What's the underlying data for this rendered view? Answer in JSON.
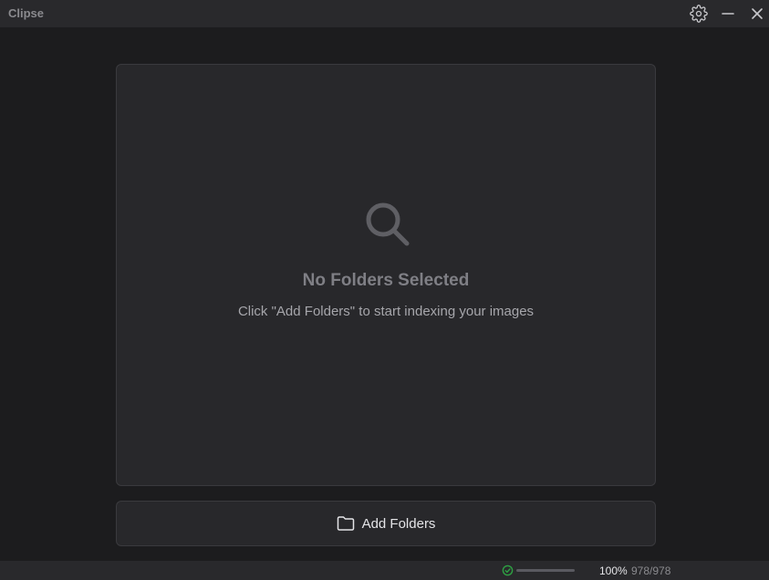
{
  "app": {
    "title": "Clipse"
  },
  "titlebar": {
    "settings_icon": "gear-icon",
    "minimize_icon": "minimize-icon",
    "close_icon": "close-icon"
  },
  "empty_state": {
    "icon": "search-icon",
    "title": "No Folders Selected",
    "subtitle": "Click \"Add Folders\" to start indexing your images"
  },
  "add_folders": {
    "icon": "folder-icon",
    "label": "Add Folders"
  },
  "status": {
    "icon": "check-circle-icon",
    "progress_fraction": 1.0,
    "percent_text": "100%",
    "count_text": "978/978"
  },
  "colors": {
    "background": "#1c1c1e",
    "panel": "#28282b",
    "titlebar": "#29292c",
    "success": "#2ea043"
  }
}
